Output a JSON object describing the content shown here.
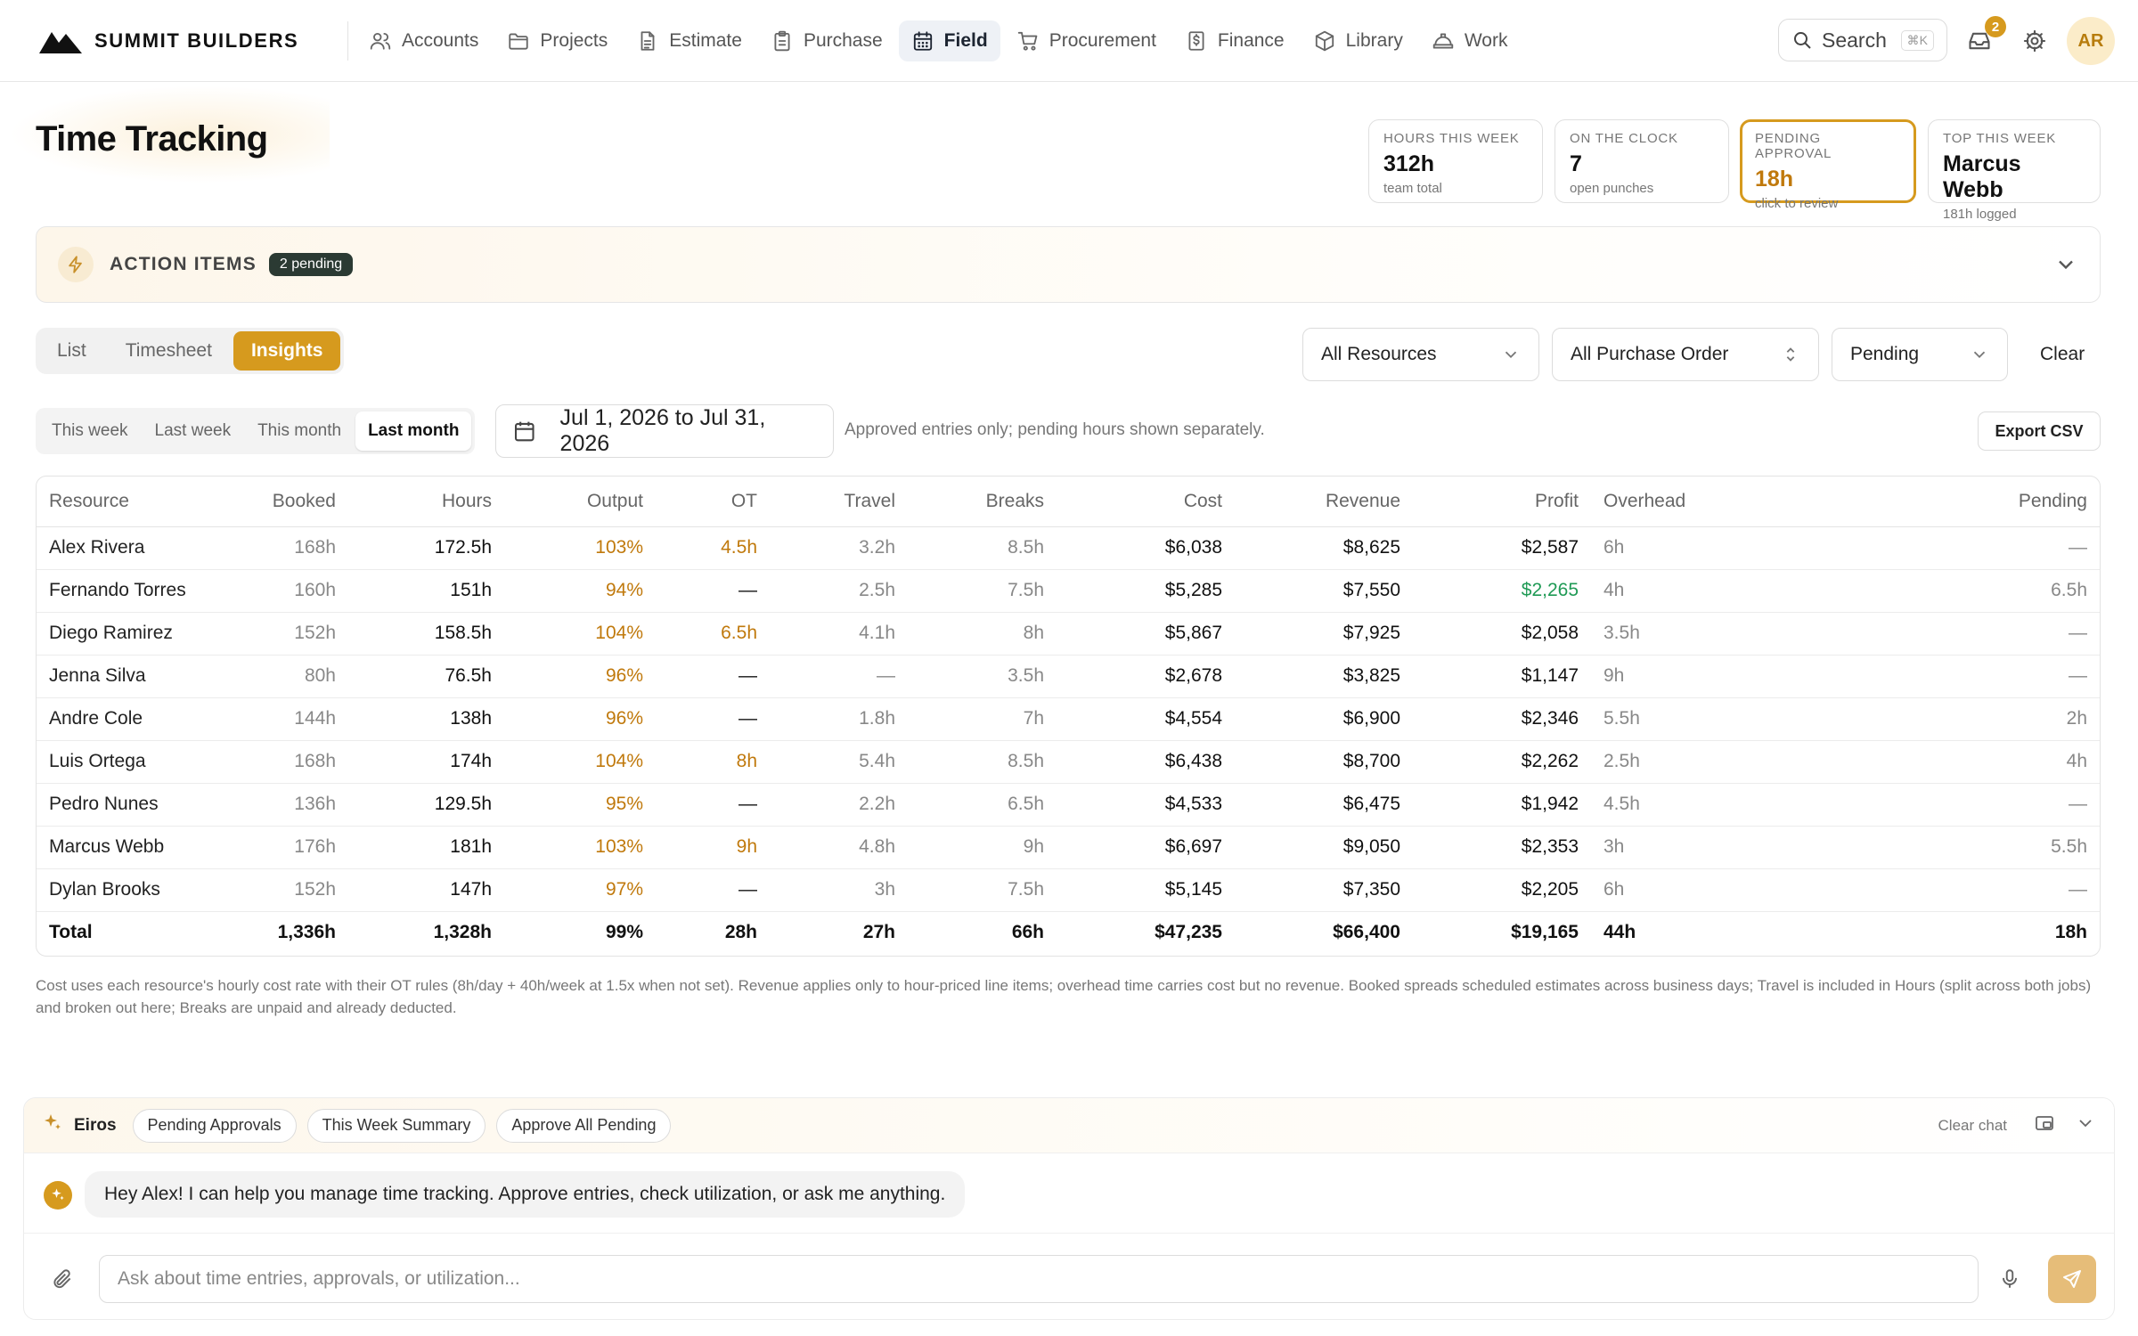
{
  "brand": {
    "name": "SUMMIT BUILDERS"
  },
  "nav": [
    {
      "label": "Accounts",
      "icon": "users-icon"
    },
    {
      "label": "Projects",
      "icon": "folder-icon"
    },
    {
      "label": "Estimate",
      "icon": "document-icon"
    },
    {
      "label": "Purchase",
      "icon": "clipboard-icon"
    },
    {
      "label": "Field",
      "icon": "calendar-icon",
      "active": true
    },
    {
      "label": "Procurement",
      "icon": "cart-icon"
    },
    {
      "label": "Finance",
      "icon": "dollar-doc-icon"
    },
    {
      "label": "Library",
      "icon": "box-icon"
    },
    {
      "label": "Work",
      "icon": "helmet-icon"
    }
  ],
  "search": {
    "label": "Search",
    "shortcut": "⌘K"
  },
  "notifications": {
    "count": "2"
  },
  "user": {
    "initials": "AR"
  },
  "page": {
    "title": "Time Tracking"
  },
  "stats": [
    {
      "label": "Hours this week",
      "value": "312h",
      "sub": "team total"
    },
    {
      "label": "On the clock",
      "value": "7",
      "sub": "open punches"
    },
    {
      "label": "Pending approval",
      "value": "18h",
      "sub": "click to review"
    },
    {
      "label": "Top this week",
      "value": "Marcus Webb",
      "sub": "181h logged"
    }
  ],
  "action_items": {
    "title": "ACTION ITEMS",
    "badge": "2 pending"
  },
  "views": [
    "List",
    "Timesheet",
    "Insights"
  ],
  "active_view": "Insights",
  "filters": {
    "resources": "All Resources",
    "purchase_order": "All Purchase Order",
    "status": "Pending",
    "clear_label": "Clear"
  },
  "ranges": [
    "This week",
    "Last week",
    "This month",
    "Last month"
  ],
  "active_range": "Last month",
  "date_range": "Jul 1, 2026 to Jul 31, 2026",
  "range_note": "Approved entries only; pending hours shown separately.",
  "export_label": "Export CSV",
  "table": {
    "columns": [
      "Resource",
      "Booked",
      "Hours",
      "Output",
      "OT",
      "Travel",
      "Breaks",
      "Cost",
      "Revenue",
      "Profit",
      "Overhead",
      "Pending"
    ],
    "rows": [
      [
        "Alex Rivera",
        "168h",
        "172.5h",
        "103%",
        "4.5h",
        "3.2h",
        "8.5h",
        "$6,038",
        "$8,625",
        "$2,587",
        "6h",
        "—"
      ],
      [
        "Fernando Torres",
        "160h",
        "151h",
        "94%",
        "—",
        "2.5h",
        "7.5h",
        "$5,285",
        "$7,550",
        "$2,265",
        "4h",
        "6.5h"
      ],
      [
        "Diego Ramirez",
        "152h",
        "158.5h",
        "104%",
        "6.5h",
        "4.1h",
        "8h",
        "$5,867",
        "$7,925",
        "$2,058",
        "3.5h",
        "—"
      ],
      [
        "Jenna Silva",
        "80h",
        "76.5h",
        "96%",
        "—",
        "—",
        "3.5h",
        "$2,678",
        "$3,825",
        "$1,147",
        "9h",
        "—"
      ],
      [
        "Andre Cole",
        "144h",
        "138h",
        "96%",
        "—",
        "1.8h",
        "7h",
        "$4,554",
        "$6,900",
        "$2,346",
        "5.5h",
        "2h"
      ],
      [
        "Luis Ortega",
        "168h",
        "174h",
        "104%",
        "8h",
        "5.4h",
        "8.5h",
        "$6,438",
        "$8,700",
        "$2,262",
        "2.5h",
        "4h"
      ],
      [
        "Pedro Nunes",
        "136h",
        "129.5h",
        "95%",
        "—",
        "2.2h",
        "6.5h",
        "$4,533",
        "$6,475",
        "$1,942",
        "4.5h",
        "—"
      ],
      [
        "Marcus Webb",
        "176h",
        "181h",
        "103%",
        "9h",
        "4.8h",
        "9h",
        "$6,697",
        "$9,050",
        "$2,353",
        "3h",
        "5.5h"
      ],
      [
        "Dylan Brooks",
        "152h",
        "147h",
        "97%",
        "—",
        "3h",
        "7.5h",
        "$5,145",
        "$7,350",
        "$2,205",
        "6h",
        "—"
      ]
    ],
    "total": [
      "Total",
      "1,336h",
      "1,328h",
      "99%",
      "28h",
      "27h",
      "66h",
      "$47,235",
      "$66,400",
      "$19,165",
      "44h",
      "18h"
    ]
  },
  "footnote": "Cost uses each resource's hourly cost rate with their OT rules (8h/day + 40h/week at 1.5x when not set). Revenue applies only to hour-priced line items; overhead time carries cost but no revenue. Booked spreads scheduled estimates across business days; Travel is included in Hours (split across both jobs) and broken out here; Breaks are unpaid and already deducted.",
  "assistant": {
    "name": "Eiros",
    "chips": [
      "Pending Approvals",
      "This Week Summary",
      "Approve All Pending"
    ],
    "clear_label": "Clear chat",
    "message": "Hey Alex! I can help you manage time tracking. Approve entries, check utilization, or ask me anything.",
    "placeholder": "Ask about time entries, approvals, or utilization..."
  },
  "colors": {
    "accent": "#d69a1e",
    "accent_text": "#c0790c",
    "positive": "#1f9a55",
    "nav_active_bg": "#eef1f6"
  }
}
